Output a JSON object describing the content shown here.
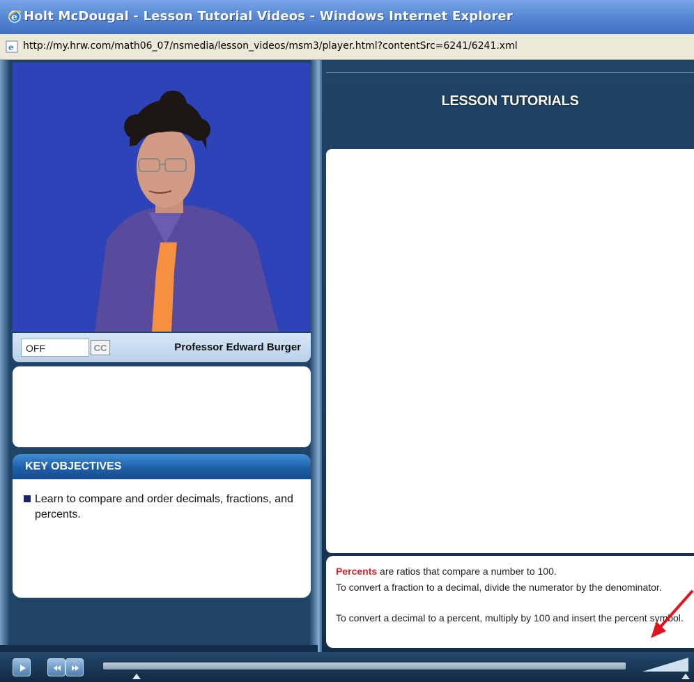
{
  "window": {
    "title": "Holt McDougal - Lesson Tutorial Videos - Windows Internet Explorer",
    "url": "http://my.hrw.com/math06_07/nsmedia/lesson_videos/msm3/player.html?contentSrc=6241/6241.xml"
  },
  "player": {
    "cc_value": "OFF",
    "cc_button_label": "CC",
    "presenter": "Professor Edward Burger"
  },
  "objectives": {
    "header": "KEY OBJECTIVES",
    "items": [
      "Learn to compare and order decimals, fractions, and percents."
    ]
  },
  "lesson": {
    "title": "LESSON TUTORIALS"
  },
  "notes": {
    "term": "Percents",
    "term_rest": " are ratios that compare a number to 100.",
    "line2": "To convert a fraction to a decimal, divide the numerator by the denominator.",
    "line3": "To convert a decimal to a percent, multiply by 100 and insert the percent symbol."
  },
  "icons": {
    "browser": "internet-explorer-icon",
    "page": "ie-page-icon",
    "play": "play-icon",
    "rewind": "rewind-icon",
    "forward": "fast-forward-icon",
    "annotation": "red-arrow-icon"
  },
  "colors": {
    "accent_red": "#d4232b",
    "video_background": "#2d43b8",
    "objectives_header": "#1e5ea8"
  }
}
